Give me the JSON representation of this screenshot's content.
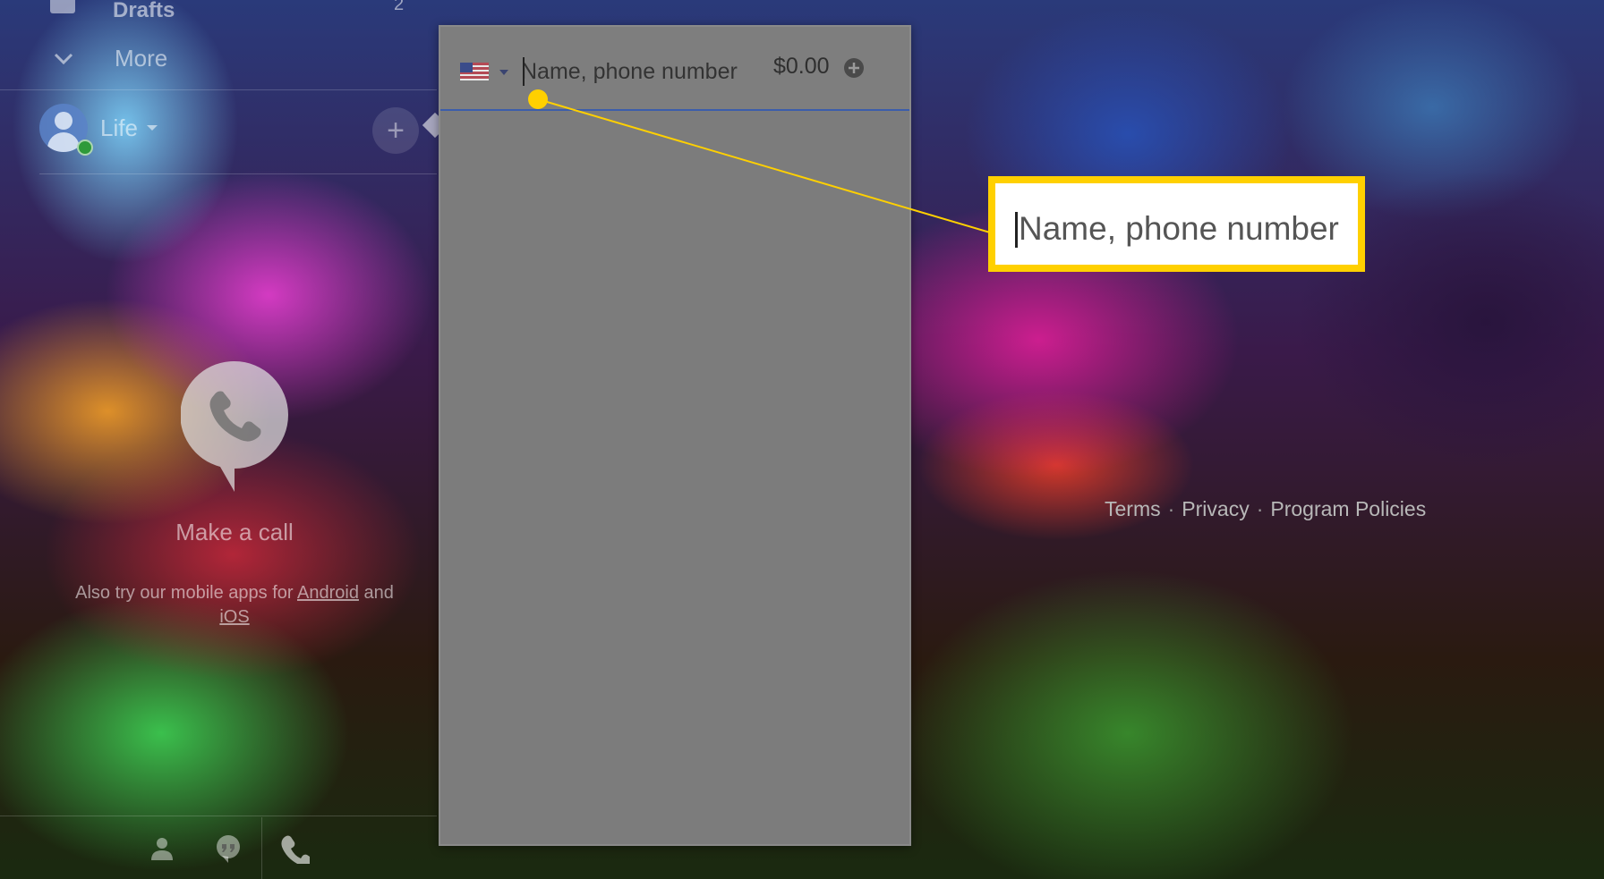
{
  "sidebar": {
    "drafts_label": "Drafts",
    "drafts_count": "2",
    "more_label": "More",
    "account_name": "Life",
    "add_label": "+"
  },
  "call_panel": {
    "make_call": "Make a call",
    "mobile_prefix": "Also try our mobile apps for ",
    "android_link": "Android",
    "and_text": " and ",
    "ios_link": "iOS"
  },
  "dialer": {
    "country": "United States",
    "search_placeholder": "Name, phone number",
    "credit": "$0.00"
  },
  "footer": {
    "terms": "Terms",
    "privacy": "Privacy",
    "program_policies": "Program Policies",
    "separator": "·"
  },
  "callout": {
    "text": "Name, phone number",
    "color": "#ffd000"
  },
  "icons": {
    "more": "chevron-down-icon",
    "account": "avatar-icon",
    "call": "phone-bubble-icon",
    "contacts": "person-icon",
    "messages": "quote-bubble-icon",
    "phone": "phone-icon",
    "credit": "add-circle-icon",
    "country": "us-flag-icon"
  }
}
